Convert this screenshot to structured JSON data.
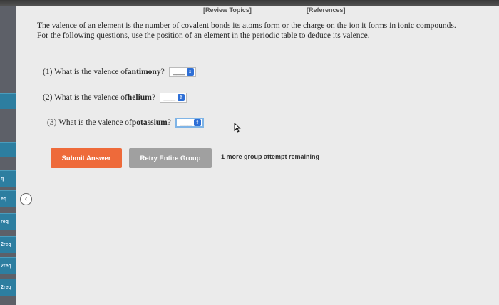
{
  "header": {
    "review_topics": "[Review Topics]",
    "references": "[References]"
  },
  "intro": {
    "line1": "The valence of an element is the number of covalent bonds its atoms form or the charge on the ion it forms in ionic compounds.",
    "line2": "For the following questions, use the position of an element in the periodic table to deduce its valence."
  },
  "questions": [
    {
      "prefix": "(1) What is the valence of ",
      "element": "antimony",
      "suffix": "?",
      "selected": "___"
    },
    {
      "prefix": "(2) What is the valence of ",
      "element": "helium",
      "suffix": "?",
      "selected": "___"
    },
    {
      "prefix": "(3) What is the valence of ",
      "element": "potassium",
      "suffix": "?",
      "selected": "___"
    }
  ],
  "buttons": {
    "submit": "Submit Answer",
    "retry": "Retry Entire Group"
  },
  "attempts_text": "1 more group attempt remaining",
  "sidebar": {
    "items": [
      "q",
      "eq",
      "req",
      "2req",
      "2req",
      "2req"
    ]
  },
  "colors": {
    "submit": "#ee6a3a",
    "retry": "#a0a0a0",
    "sidebar_item": "#2d7ea0",
    "select_arrows": "#2e6fd6"
  },
  "icons": {
    "collapse": "chevron-left-icon",
    "select": "up-down-arrows-icon",
    "cursor": "mouse-pointer-icon"
  }
}
